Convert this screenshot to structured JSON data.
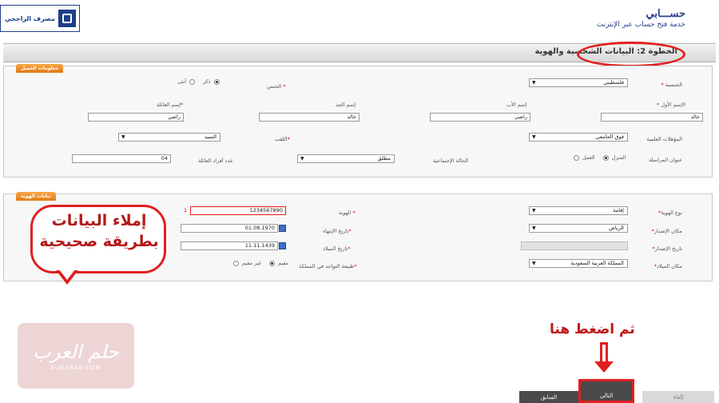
{
  "header": {
    "logo_text": "مصرف الراجحي",
    "brand_title": "حســـابي",
    "brand_subtitle": "خدمة فتح حساب عبر الإنترنت"
  },
  "step": {
    "label": "الخطوة 2: البيانات الشخصية والهوية"
  },
  "customer_panel": {
    "tab": "معلومات العميل",
    "nationality": {
      "label": "الجنسية",
      "value": "فلسطيني"
    },
    "gender": {
      "label": "الجنس",
      "male": "ذكر",
      "female": "أنثى"
    },
    "first_name": {
      "label": "الإسم الأول",
      "value": "خالد"
    },
    "father_name": {
      "label": "إسم الأب",
      "value": "راضي"
    },
    "grandfather_name": {
      "label": "إسم الجد",
      "value": "خالد"
    },
    "family_name": {
      "label": "إسم العائلة",
      "value": "راضي"
    },
    "education": {
      "label": "المؤهلات العلمية",
      "value": "فوق الجامعي"
    },
    "title": {
      "label": "اللقب",
      "value": "السيد"
    },
    "mailing_address": {
      "label": "عنوان المراسلة",
      "home": "المنزل",
      "work": "العمل"
    },
    "marital_status": {
      "label": "الحالة الإجتماعية",
      "value": "مطلق"
    },
    "family_count": {
      "label": "عدد أفراد العائلة",
      "value": "04"
    }
  },
  "id_panel": {
    "tab": "بيانات الهوية",
    "id_type": {
      "label": "نوع الهوية",
      "value": "إقامة"
    },
    "id_number": {
      "label": "الهوية",
      "value": "1234567890",
      "mark": "1"
    },
    "issue_place": {
      "label": "مكان الإصدار",
      "value": "الرياض"
    },
    "issue_date": {
      "label": "تاريخ الإصدار"
    },
    "expiry_date": {
      "label": "تاريخ الإنتهاء",
      "value": "01.08.1970"
    },
    "birth_date": {
      "label": "تاريخ الميلاد",
      "value": "11.11.1439"
    },
    "birth_place": {
      "label": "مكان الميلاد",
      "value": "المملكة العربية السعودية"
    },
    "residence_status": {
      "label": "طبيعة التواجد في المملكة",
      "resident": "مقيم",
      "non_resident": "غير مقيم"
    }
  },
  "annotations": {
    "fill_callout": "إملاء البيانات بطريقة صحيحية",
    "click_callout": "ثم اضغط هنا"
  },
  "watermark": {
    "script": "حلم العرب",
    "latin": "ELMARAB.COM"
  },
  "nav": {
    "previous": "السابق",
    "next": "التالي",
    "cancel": "إلغاء"
  },
  "colors": {
    "accent_red": "#e02020",
    "brand_blue": "#1e3f8a",
    "tab_orange": "#e07b13"
  }
}
